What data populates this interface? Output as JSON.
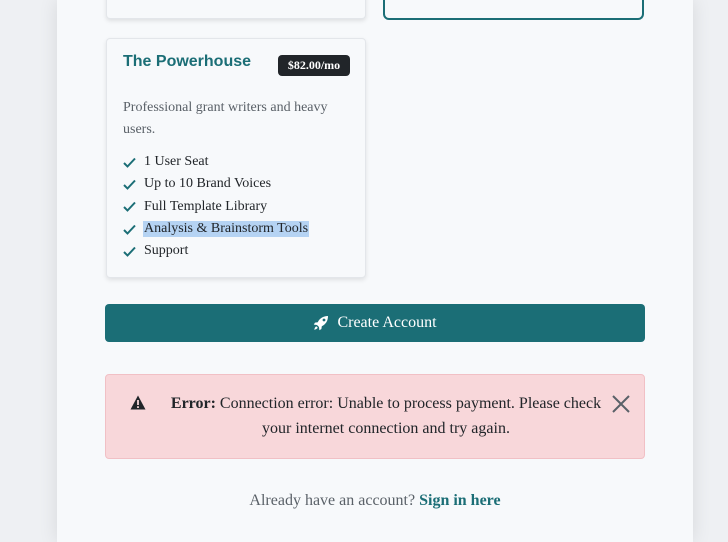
{
  "plan": {
    "name": "The Powerhouse",
    "price": "$82.00/mo",
    "description": "Professional grant writers and heavy users.",
    "features": [
      "1 User Seat",
      "Up to 10 Brand Voices",
      "Full Template Library",
      "Analysis & Brainstorm Tools",
      "Support"
    ]
  },
  "actions": {
    "create_account_label": "Create Account"
  },
  "alert": {
    "label": "Error:",
    "message": "Connection error: Unable to process payment. Please check your internet connection and try again."
  },
  "signin": {
    "prompt": "Already have an account?",
    "link": "Sign in here"
  },
  "colors": {
    "accent": "#1b6e76",
    "error_bg": "#f8d7da",
    "badge_bg": "#212529",
    "selection": "#b5d3f3"
  },
  "icons": {
    "feature": "check-icon",
    "create_button": "rocket-icon",
    "alert": "warning-triangle-icon",
    "alert_close": "close-icon"
  }
}
